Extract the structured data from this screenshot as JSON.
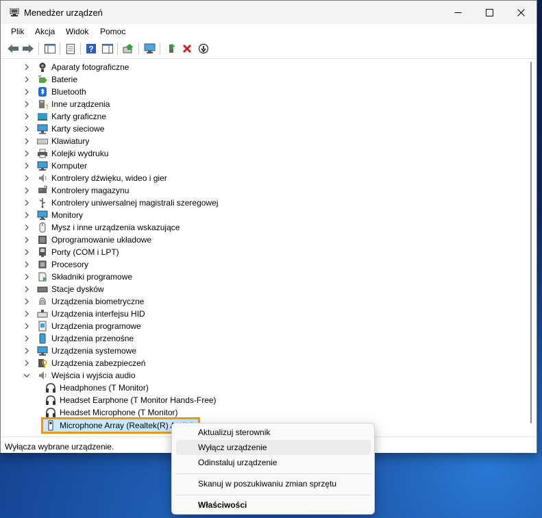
{
  "window": {
    "title": "Menedżer urządzeń"
  },
  "menu": [
    "Plik",
    "Akcja",
    "Widok",
    "Pomoc"
  ],
  "tree": {
    "categories": [
      {
        "label": "Aparaty fotograficzne",
        "icon": "camera-icon"
      },
      {
        "label": "Baterie",
        "icon": "battery-icon"
      },
      {
        "label": "Bluetooth",
        "icon": "bluetooth-icon"
      },
      {
        "label": "Inne urządzenia",
        "icon": "unknown-device-icon"
      },
      {
        "label": "Karty graficzne",
        "icon": "display-adapter-icon"
      },
      {
        "label": "Karty sieciowe",
        "icon": "network-adapter-icon"
      },
      {
        "label": "Klawiatury",
        "icon": "keyboard-icon"
      },
      {
        "label": "Kolejki wydruku",
        "icon": "printer-icon"
      },
      {
        "label": "Komputer",
        "icon": "computer-icon"
      },
      {
        "label": "Kontrolery dźwięku, wideo i gier",
        "icon": "speaker-icon"
      },
      {
        "label": "Kontrolery magazynu",
        "icon": "storage-controller-icon"
      },
      {
        "label": "Kontrolery uniwersalnej magistrali szeregowej",
        "icon": "usb-icon"
      },
      {
        "label": "Monitory",
        "icon": "monitor-icon"
      },
      {
        "label": "Mysz i inne urządzenia wskazujące",
        "icon": "mouse-icon"
      },
      {
        "label": "Oprogramowanie układowe",
        "icon": "firmware-icon"
      },
      {
        "label": "Porty (COM i LPT)",
        "icon": "port-icon"
      },
      {
        "label": "Procesory",
        "icon": "processor-icon"
      },
      {
        "label": "Składniki programowe",
        "icon": "software-component-icon"
      },
      {
        "label": "Stacje dysków",
        "icon": "disk-drive-icon"
      },
      {
        "label": "Urządzenia biometryczne",
        "icon": "fingerprint-icon"
      },
      {
        "label": "Urządzenia interfejsu HID",
        "icon": "hid-icon"
      },
      {
        "label": "Urządzenia programowe",
        "icon": "software-device-icon"
      },
      {
        "label": "Urządzenia przenośne",
        "icon": "portable-device-icon"
      },
      {
        "label": "Urządzenia systemowe",
        "icon": "system-device-icon"
      },
      {
        "label": "Urządzenia zabezpieczeń",
        "icon": "security-device-icon"
      }
    ],
    "expanded": {
      "label": "Wejścia i wyjścia audio",
      "icon": "audio-io-icon",
      "children": [
        {
          "label": "Headphones (T Monitor)",
          "icon": "headphones-icon"
        },
        {
          "label": "Headset Earphone (T Monitor Hands-Free)",
          "icon": "headphones-icon"
        },
        {
          "label": "Headset Microphone (T Monitor)",
          "icon": "headphones-icon"
        },
        {
          "label": "Microphone Array (Realtek(R) Audio)",
          "icon": "microphone-icon",
          "selected": true
        }
      ]
    }
  },
  "status": {
    "text": "Wyłącza wybrane urządzenie."
  },
  "context_menu": {
    "update_driver": "Aktualizuj sterownik",
    "disable_device": "Wyłącz urządzenie",
    "uninstall_device": "Odinstaluj urządzenie",
    "scan_changes": "Skanuj w poszukiwaniu zmian sprzętu",
    "properties": "Właściwości"
  },
  "colors": {
    "selection": "#cce8ff",
    "highlight_outline": "#f0961e",
    "remove_red": "#d01e1e"
  }
}
